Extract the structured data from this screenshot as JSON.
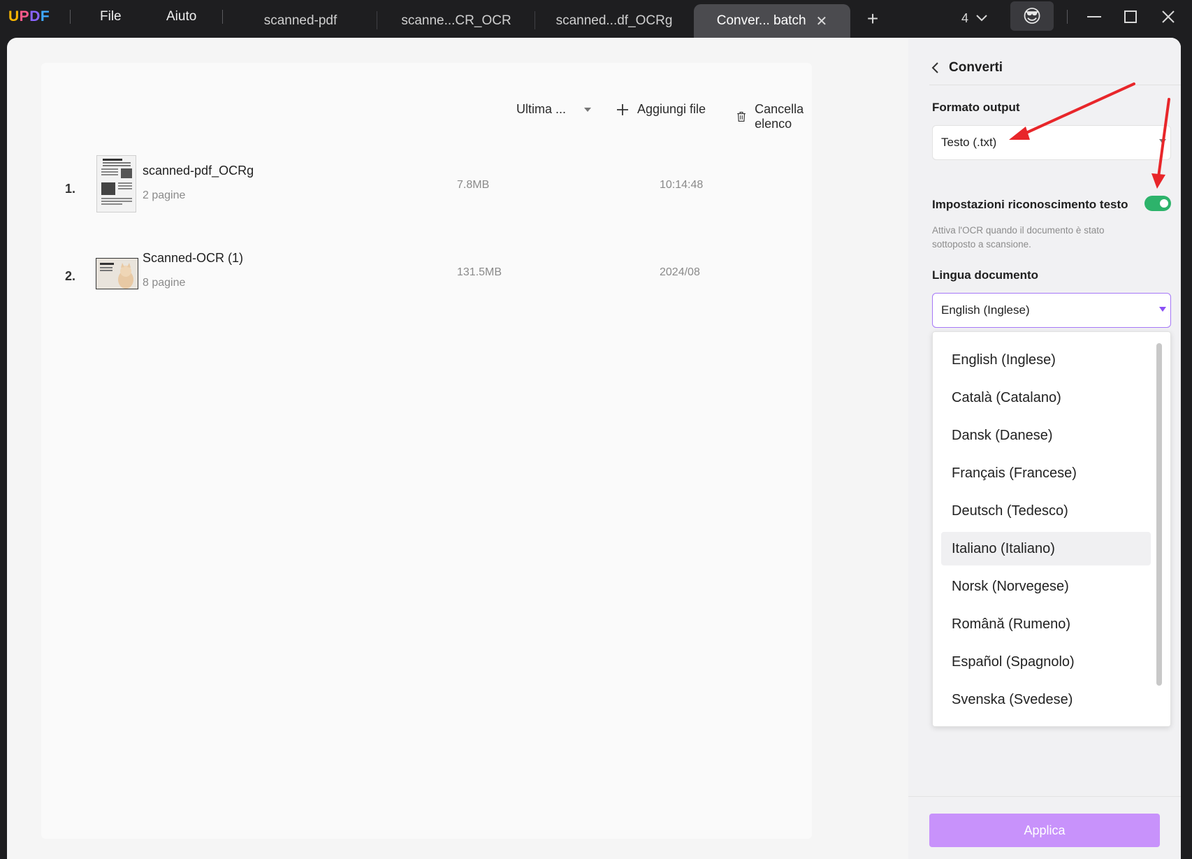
{
  "app": {
    "logo": [
      "U",
      "P",
      "D",
      "F"
    ]
  },
  "menu": {
    "file": "File",
    "help": "Aiuto"
  },
  "tabs": [
    {
      "label": "scanned-pdf"
    },
    {
      "label": "scanne...CR_OCR"
    },
    {
      "label": "scanned...df_OCRg"
    },
    {
      "label": "Conver... batch",
      "active": true
    }
  ],
  "titlebar": {
    "new_tab": "+",
    "tab_count": "4",
    "emoji": "😎"
  },
  "toolbar": {
    "sort": "Ultima ...",
    "add_files": "Aggiungi file",
    "clear_list": "Cancella elenco"
  },
  "files": [
    {
      "num": "1.",
      "name": "scanned-pdf_OCRg",
      "pages": "2 pagine",
      "size": "7.8MB",
      "time": "10:14:48"
    },
    {
      "num": "2.",
      "name": "Scanned-OCR (1)",
      "pages": "8 pagine",
      "size": "131.5MB",
      "time": "2024/08"
    }
  ],
  "panel": {
    "title": "Converti",
    "output_format_label": "Formato output",
    "output_format_value": "Testo (.txt)",
    "ocr_label": "Impostazioni riconoscimento testo",
    "ocr_enabled": true,
    "ocr_hint": "Attiva l'OCR quando il documento è stato sottoposto a scansione.",
    "language_label": "Lingua documento",
    "language_value": "English (Inglese)",
    "language_options": [
      "English (Inglese)",
      "Català (Catalano)",
      "Dansk (Danese)",
      "Français (Francese)",
      "Deutsch (Tedesco)",
      "Italiano (Italiano)",
      "Norsk (Norvegese)",
      "Română (Rumeno)",
      "Español (Spagnolo)",
      "Svenska (Svedese)"
    ],
    "hovered_option": 5,
    "apply": "Applica"
  },
  "colors": {
    "accent": "#c892fb",
    "toggle_on": "#2db36b",
    "annotation_arrow": "#e8262a"
  }
}
